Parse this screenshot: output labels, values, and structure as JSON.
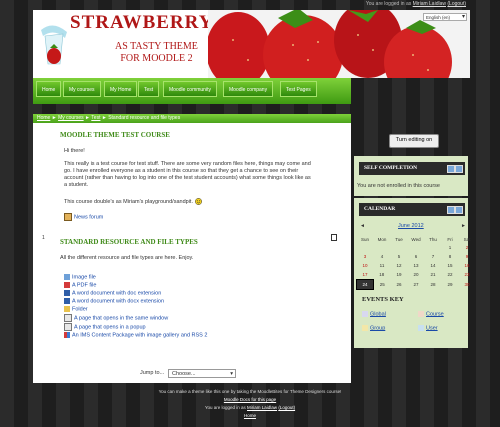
{
  "login_top": {
    "prefix": "You are logged in as ",
    "user": "Miriam Laidlaw",
    "logout": "(Logout)"
  },
  "header": {
    "title": "STRAWBERRY",
    "tagline_1": "AS TASTY THEME",
    "tagline_2": "FOR MOODLE 2",
    "language": "English (en)"
  },
  "nav": {
    "tabs": [
      "Home",
      "My courses",
      "My Home",
      "Test",
      "Moodle community",
      "Moodle company",
      "Test Pages"
    ]
  },
  "breadcrumb": {
    "items": [
      "Home",
      "My courses",
      "Test",
      "Standard resource and file types"
    ],
    "separator": "►"
  },
  "course": {
    "title": "MOODLE THEME TEST COURSE",
    "greeting": "Hi there!",
    "para1": "This really is a test course for test stuff. There are some very random files here, things may come and go. I have enrolled everyone as a student in this course so that they get a chance to see on their account (rather than having to log into one of the test student accounts) what some things look like as a student.",
    "para2": "This course double's as Miriam's playground/sandpit.",
    "forum": "News forum"
  },
  "section": {
    "number": "1",
    "title": "STANDARD RESOURCE AND FILE TYPES",
    "summary": "All the different resource and file types are here. Enjoy.",
    "resources": [
      "Image file",
      "A PDF file",
      "A word document with doc extension",
      "A word document with docx extension",
      "Folder",
      "A page that opens in the same window",
      "A page that opens in a popup",
      "An IMS Content Package with image gallery and RSS 2"
    ]
  },
  "jump": {
    "label": "Jump to...",
    "value": "Choose..."
  },
  "sidebar": {
    "turn_editing": "Turn editing on",
    "self_completion": {
      "title": "SELF COMPLETION",
      "text": "You are not enrolled in this course"
    },
    "calendar": {
      "title": "CALENDAR",
      "month": "June 2012",
      "prev": "◄",
      "next": "►",
      "days": [
        "Sun",
        "Mon",
        "Tue",
        "Wed",
        "Thu",
        "Fri",
        "Sat"
      ],
      "weeks": [
        [
          "",
          "",
          "",
          "",
          "",
          "1",
          "2"
        ],
        [
          "3",
          "4",
          "5",
          "6",
          "7",
          "8",
          "9"
        ],
        [
          "10",
          "11",
          "12",
          "13",
          "14",
          "15",
          "16"
        ],
        [
          "17",
          "18",
          "19",
          "20",
          "21",
          "22",
          "23"
        ],
        [
          "24",
          "25",
          "26",
          "27",
          "28",
          "29",
          "30"
        ]
      ],
      "today": "24"
    },
    "events_key": {
      "title": "EVENTS KEY",
      "items": [
        "Global",
        "Course",
        "Group",
        "User"
      ]
    }
  },
  "footer": {
    "line1": "You can make a theme like this one by taking the MoodleBites for Theme Designers course!",
    "line2": "Moodle Docs for this page",
    "line3_prefix": "You are logged in as ",
    "line3_user": "Miriam Laidlaw",
    "line3_logout": "(Logout)",
    "home": "Home"
  },
  "colors": {
    "accent": "#5bb51f",
    "title_red": "#b01717",
    "block_bg": "#d9e8c4"
  }
}
